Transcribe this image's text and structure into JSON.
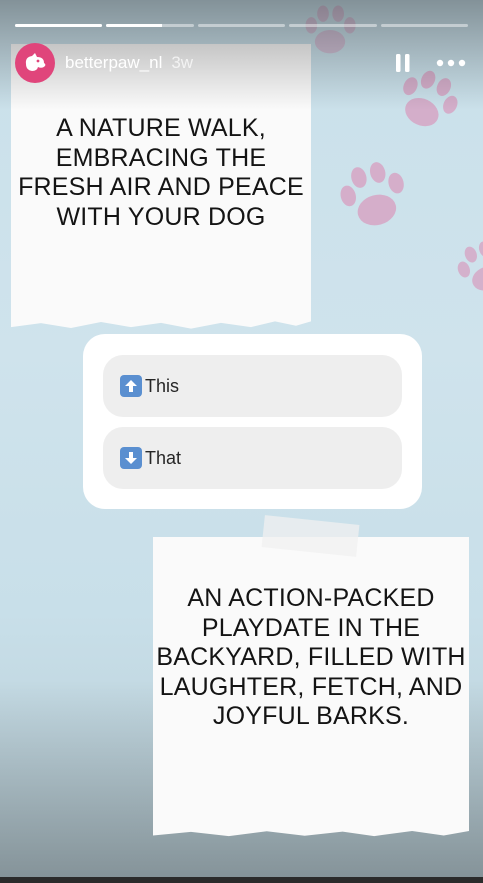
{
  "progress": [
    {
      "fill": 1.0
    },
    {
      "fill": 0.64
    },
    {
      "fill": 0
    },
    {
      "fill": 0
    },
    {
      "fill": 0
    }
  ],
  "header": {
    "username": "betterpaw_nl",
    "time": "3w",
    "avatar_icon": "dog-logo-icon",
    "pause_icon": "pause-icon",
    "more_icon": "more-options-icon"
  },
  "card_top": {
    "text": "A NATURE WALK, EMBRACING THE FRESH AIR AND PEACE WITH YOUR DOG"
  },
  "poll": {
    "options": [
      {
        "label": "This",
        "icon": "up-arrow-icon"
      },
      {
        "label": "That",
        "icon": "down-arrow-icon"
      }
    ]
  },
  "card_bottom": {
    "text": "AN ACTION-PACKED PLAYDATE IN THE BACKYARD, FILLED WITH LAUGHTER, FETCH, AND JOYFUL BARKS."
  },
  "colors": {
    "background": "#c9e0ea",
    "paw": "#d6a9c7",
    "avatar": "#e0457b",
    "poll_icon": "#5a8fd0"
  }
}
